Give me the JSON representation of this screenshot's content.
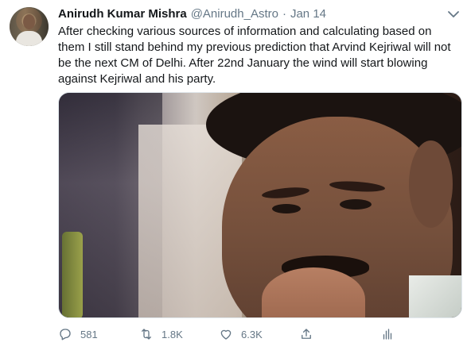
{
  "tweet": {
    "author_name": "Anirudh Kumar Mishra",
    "handle": "@Anirudh_Astro",
    "separator": "·",
    "date": "Jan 14",
    "text": "After checking various sources of information and calculating based on them I still stand behind my previous prediction that Arvind Kejriwal will not be the next CM of Delhi.  After 22nd January the wind will start blowing against Kejriwal and his party.",
    "media": {
      "description_icon": "photo"
    }
  },
  "actions": {
    "reply": {
      "icon": "reply-icon",
      "count": "581"
    },
    "retweet": {
      "icon": "retweet-icon",
      "count": "1.8K"
    },
    "like": {
      "icon": "heart-icon",
      "count": "6.3K"
    },
    "share": {
      "icon": "share-icon"
    },
    "analytics": {
      "icon": "analytics-icon"
    }
  },
  "colors": {
    "text_primary": "#14171a",
    "text_secondary": "#657786",
    "border": "#e1e8ed"
  }
}
